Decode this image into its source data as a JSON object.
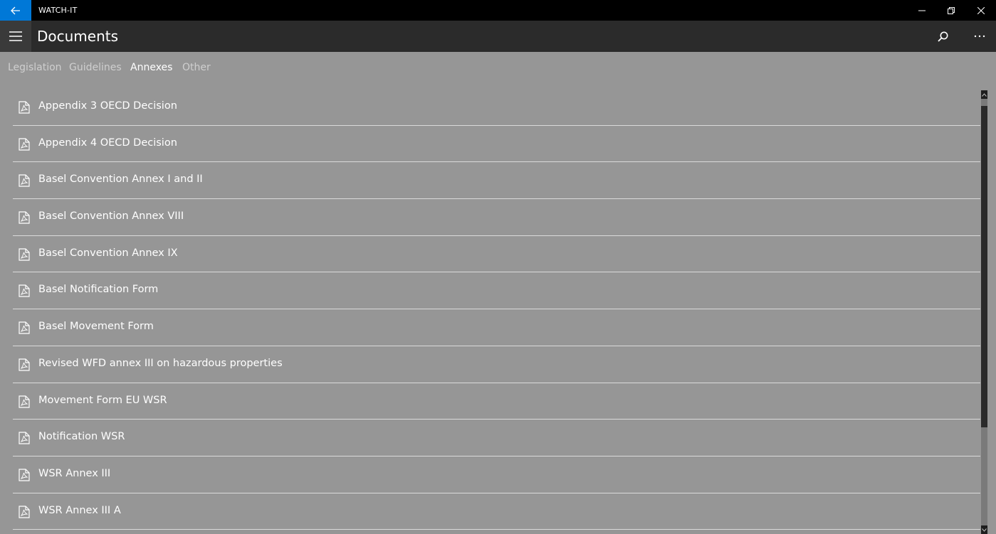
{
  "window": {
    "title": "WATCH-IT",
    "controls": [
      "minimize-icon",
      "restore-icon",
      "close-icon"
    ]
  },
  "header": {
    "title": "Documents",
    "icons": [
      "hamburger-icon",
      "search-icon",
      "more-icon"
    ]
  },
  "tabs": [
    {
      "label": "Legislation",
      "active": false
    },
    {
      "label": "Guidelines",
      "active": false
    },
    {
      "label": "Annexes",
      "active": true
    },
    {
      "label": "Other",
      "active": false
    }
  ],
  "documents": [
    {
      "label": "Appendix 3 OECD Decision",
      "icon": "pdf-icon"
    },
    {
      "label": "Appendix 4 OECD Decision",
      "icon": "pdf-icon"
    },
    {
      "label": "Basel Convention Annex I and II",
      "icon": "pdf-icon"
    },
    {
      "label": "Basel Convention Annex VIII",
      "icon": "pdf-icon"
    },
    {
      "label": "Basel Convention Annex IX",
      "icon": "pdf-icon"
    },
    {
      "label": "Basel Notification Form",
      "icon": "pdf-icon"
    },
    {
      "label": "Basel Movement Form",
      "icon": "pdf-icon"
    },
    {
      "label": "Revised WFD annex III on hazardous properties",
      "icon": "pdf-icon"
    },
    {
      "label": "Movement Form EU WSR",
      "icon": "pdf-icon"
    },
    {
      "label": "Notification WSR",
      "icon": "pdf-icon"
    },
    {
      "label": "WSR Annex III",
      "icon": "pdf-icon"
    },
    {
      "label": "WSR Annex III A",
      "icon": "pdf-icon"
    }
  ],
  "colors": {
    "accent": "#0078d7",
    "titlebar": "#000000",
    "appbar": "#2b2b2b",
    "background": "#969696"
  }
}
